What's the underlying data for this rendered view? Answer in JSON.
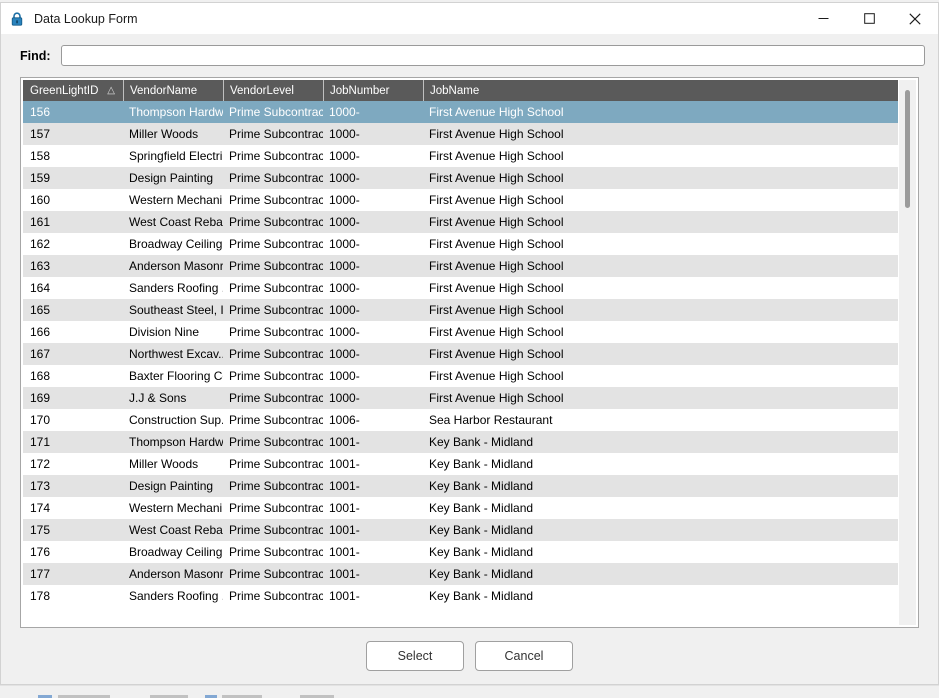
{
  "window": {
    "title": "Data Lookup Form",
    "title_icon": "lock-icon",
    "controls": {
      "minimize": "minimize-icon",
      "maximize": "maximize-icon",
      "close": "close-icon"
    }
  },
  "find": {
    "label": "Find:",
    "value": "",
    "placeholder": ""
  },
  "grid": {
    "sort_indicator": "△",
    "sort_column": "GreenLightID",
    "sort_direction": "ascending",
    "columns": [
      "GreenLightID",
      "VendorName",
      "VendorLevel",
      "JobNumber",
      "JobName"
    ],
    "selected_row_index": 0,
    "rows": [
      [
        "156",
        "Thompson Hardw...",
        "Prime Subcontrac...",
        "1000-",
        "First Avenue High School"
      ],
      [
        "157",
        "Miller Woods",
        "Prime Subcontrac...",
        "1000-",
        "First Avenue High School"
      ],
      [
        "158",
        "Springfield Electri...",
        "Prime Subcontrac...",
        "1000-",
        "First Avenue High School"
      ],
      [
        "159",
        "Design Painting",
        "Prime Subcontrac...",
        "1000-",
        "First Avenue High School"
      ],
      [
        "160",
        "Western Mechani...",
        "Prime Subcontrac...",
        "1000-",
        "First Avenue High School"
      ],
      [
        "161",
        "West Coast Rebar",
        "Prime Subcontrac...",
        "1000-",
        "First Avenue High School"
      ],
      [
        "162",
        "Broadway Ceiling ...",
        "Prime Subcontrac...",
        "1000-",
        "First Avenue High School"
      ],
      [
        "163",
        "Anderson Masonry",
        "Prime Subcontrac...",
        "1000-",
        "First Avenue High School"
      ],
      [
        "164",
        "Sanders Roofing ...",
        "Prime Subcontrac...",
        "1000-",
        "First Avenue High School"
      ],
      [
        "165",
        "Southeast Steel, I...",
        "Prime Subcontrac...",
        "1000-",
        "First Avenue High School"
      ],
      [
        "166",
        "Division Nine",
        "Prime Subcontrac...",
        "1000-",
        "First Avenue High School"
      ],
      [
        "167",
        "Northwest Excav...",
        "Prime Subcontrac...",
        "1000-",
        "First Avenue High School"
      ],
      [
        "168",
        "Baxter Flooring Co.",
        "Prime Subcontrac...",
        "1000-",
        "First Avenue High School"
      ],
      [
        "169",
        "J.J & Sons",
        "Prime Subcontrac...",
        "1000-",
        "First Avenue High School"
      ],
      [
        "170",
        "Construction Sup...",
        "Prime Subcontrac...",
        "1006-",
        "Sea Harbor Restaurant"
      ],
      [
        "171",
        "Thompson Hardw...",
        "Prime Subcontrac...",
        "1001-",
        "Key Bank - Midland"
      ],
      [
        "172",
        "Miller Woods",
        "Prime Subcontrac...",
        "1001-",
        "Key Bank - Midland"
      ],
      [
        "173",
        "Design Painting",
        "Prime Subcontrac...",
        "1001-",
        "Key Bank - Midland"
      ],
      [
        "174",
        "Western Mechani...",
        "Prime Subcontrac...",
        "1001-",
        "Key Bank - Midland"
      ],
      [
        "175",
        "West Coast Rebar",
        "Prime Subcontrac...",
        "1001-",
        "Key Bank - Midland"
      ],
      [
        "176",
        "Broadway Ceiling ...",
        "Prime Subcontrac...",
        "1001-",
        "Key Bank - Midland"
      ],
      [
        "177",
        "Anderson Masonry",
        "Prime Subcontrac...",
        "1001-",
        "Key Bank - Midland"
      ],
      [
        "178",
        "Sanders Roofing ...",
        "Prime Subcontrac...",
        "1001-",
        "Key Bank - Midland"
      ]
    ]
  },
  "footer": {
    "select_label": "Select",
    "cancel_label": "Cancel"
  },
  "colors": {
    "header_bg": "#5a5a5a",
    "selection_bg": "#7ea9c0",
    "alt_row_bg": "#e3e3e3",
    "window_bg": "#f0f0f0",
    "lock_icon": "#1d6fa5"
  }
}
